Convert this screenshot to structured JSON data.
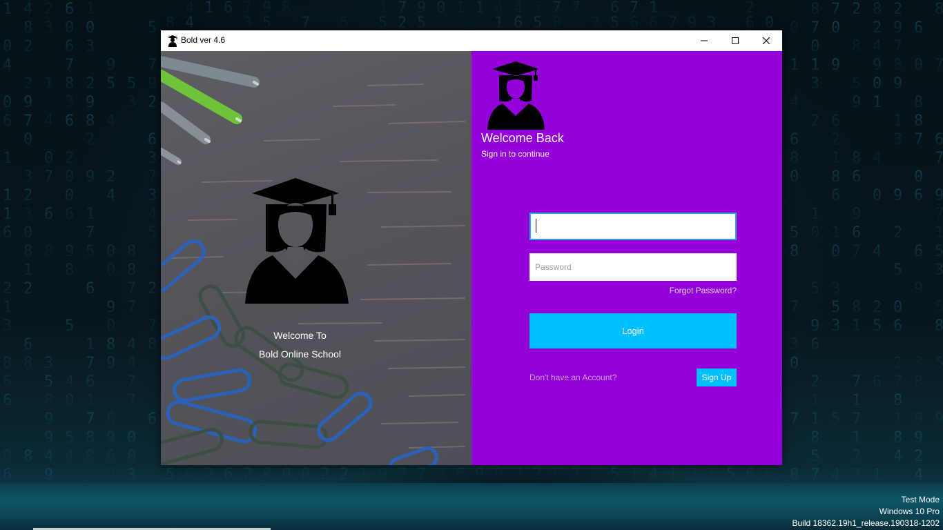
{
  "window": {
    "title": "Bold ver 4.6",
    "icon": "graduate-icon",
    "controls": {
      "minimize": "minimize-icon",
      "maximize": "maximize-icon",
      "close": "close-icon"
    }
  },
  "left_panel": {
    "icon": "graduate-icon",
    "welcome_line": "Welcome To",
    "school_name": "Bold Online School"
  },
  "right_panel": {
    "icon": "graduate-icon",
    "heading": "Welcome Back",
    "subheading": "Sign in to continue",
    "username": {
      "value": "",
      "placeholder": ""
    },
    "password": {
      "value": "",
      "placeholder": "Password"
    },
    "forgot_link": "Forgot Password?",
    "login_label": "Login",
    "no_account_text": "Don't have an Account?",
    "signup_label": "Sign Up"
  },
  "watermark": {
    "line1": "Test Mode",
    "line2": "Windows 10 Pro",
    "line3": "Build 18362.19h1_release.190318-1202"
  },
  "colors": {
    "accent_purple": "#9400d9",
    "button_blue": "#00bfff",
    "focus_border": "#2aa7e8"
  }
}
